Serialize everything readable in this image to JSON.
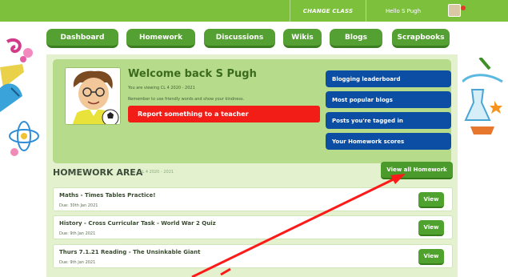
{
  "topbar": {
    "change_class": "CHANGE CLASS",
    "greeting": "Hello S Pugh"
  },
  "nav": {
    "tabs": [
      {
        "label": "Dashboard"
      },
      {
        "label": "Homework"
      },
      {
        "label": "Discussions"
      },
      {
        "label": "Wikis"
      },
      {
        "label": "Blogs"
      },
      {
        "label": "Scrapbooks"
      }
    ]
  },
  "welcome": {
    "title": "Welcome back S Pugh",
    "viewing": "You are viewing CL 4 2020 - 2021",
    "remember": "Remember to use friendly words and show your kindness.",
    "report_label": "Report something to a teacher"
  },
  "quick_links": [
    {
      "label": "Blogging leaderboard"
    },
    {
      "label": "Most popular blogs"
    },
    {
      "label": "Posts you're tagged in"
    },
    {
      "label": "Your Homework scores"
    }
  ],
  "homework": {
    "header": "HOMEWORK AREA",
    "class_label": "CL 4 2020 - 2021",
    "view_all_label": "View all Homework",
    "items": [
      {
        "title": "Maths - Times Tables Practice!",
        "due": "Due: 30th Jan 2021",
        "view_label": "View"
      },
      {
        "title": "History - Cross Curricular Task - World War 2 Quiz",
        "due": "Due: 9th Jan 2021",
        "view_label": "View"
      },
      {
        "title": "Thurs 7.1.21 Reading - The Unsinkable Giant",
        "due": "Due: 9th Jan 2021",
        "view_label": "View"
      }
    ]
  },
  "colors": {
    "brand_green": "#7cc03b",
    "tab_green": "#55a032",
    "link_blue": "#0c4ea3",
    "report_red": "#f21d17",
    "annotation_red": "#ff0000"
  }
}
